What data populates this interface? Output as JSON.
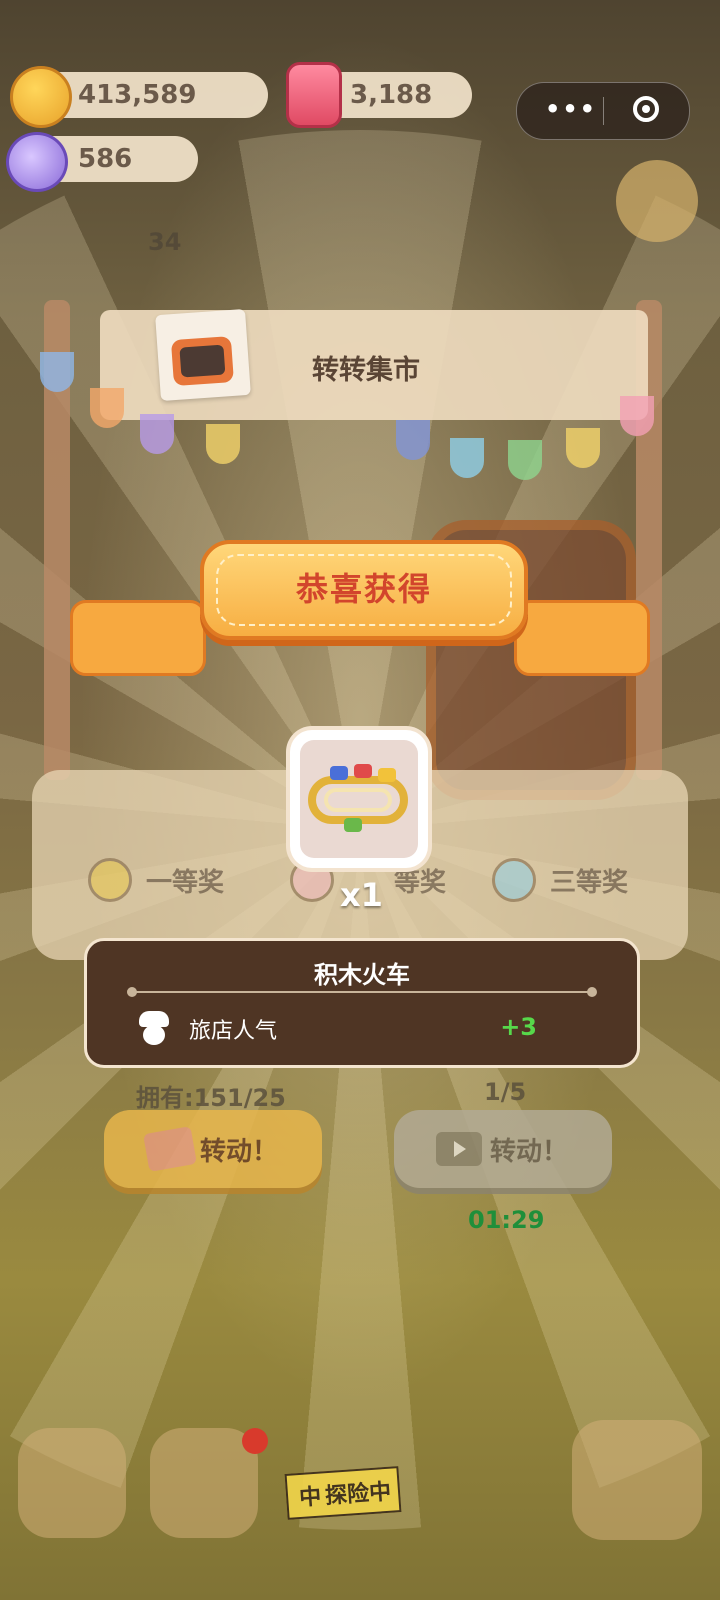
{
  "resources": {
    "coins": "413,589",
    "gems": "3,188",
    "tickets": "586"
  },
  "side_number": "34",
  "stall": {
    "title": "转转集市"
  },
  "banner": {
    "text": "恭喜获得"
  },
  "reward": {
    "item_icon": "block-train-icon",
    "quantity": "x1",
    "name": "积木火车",
    "attribute_label": "旅店人气",
    "attribute_value": "+3"
  },
  "prizes": [
    {
      "label": "一等奖",
      "color": "#e9c84a"
    },
    {
      "label": "等奖",
      "color": "#f2b8c0"
    },
    {
      "label": "三等奖",
      "color": "#8fd0e8"
    }
  ],
  "spin": {
    "owned": "拥有:151/25",
    "daily_count": "1/5",
    "button_ticket_label": "转动！",
    "button_video_label": "转动！",
    "cooldown": "01:29"
  },
  "bottom_nav": {
    "explore_tag": "探险中",
    "explore_prefix": "中"
  },
  "colors": {
    "banner_red": "#d2452c",
    "positive_green": "#57d84a",
    "timer_green": "#1f8f3a"
  }
}
